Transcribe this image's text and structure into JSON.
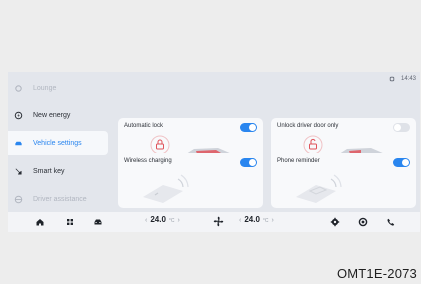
{
  "status_bar": {
    "time": "14:43"
  },
  "sidebar": {
    "items": [
      {
        "label": "Lounge",
        "icon": "lounge-icon",
        "state": "faded"
      },
      {
        "label": "New energy",
        "icon": "energy-icon",
        "state": "normal"
      },
      {
        "label": "Vehicle settings",
        "icon": "car-icon",
        "state": "active"
      },
      {
        "label": "Smart key",
        "icon": "key-icon",
        "state": "normal"
      },
      {
        "label": "Driver assistance",
        "icon": "steering-wheel-icon",
        "state": "faded"
      }
    ]
  },
  "cards": {
    "automatic_lock": {
      "title": "Automatic lock",
      "enabled": true
    },
    "unlock_driver_door": {
      "title": "Unlock driver door only",
      "enabled": false
    },
    "wireless_charging": {
      "title": "Wireless charging",
      "enabled": true
    },
    "phone_reminder": {
      "title": "Phone reminder",
      "enabled": true
    }
  },
  "bottom_bar": {
    "left_temp": {
      "value": "24.0",
      "unit": "°C",
      "prev": "‹",
      "next": "›"
    },
    "right_temp": {
      "value": "24.0",
      "unit": "°C",
      "prev": "‹",
      "next": "›"
    },
    "icons": [
      "home-icon",
      "apps-grid-icon",
      "car-icon",
      "fan-icon",
      "settings-icon",
      "target-icon",
      "phone-icon"
    ]
  },
  "caption": "OMT1E-2073",
  "colors": {
    "accent": "#2a86ef",
    "card_bg": "#f8f9fb",
    "screen_bg": "#e3e6ec",
    "lock_red": "#e0525a"
  }
}
